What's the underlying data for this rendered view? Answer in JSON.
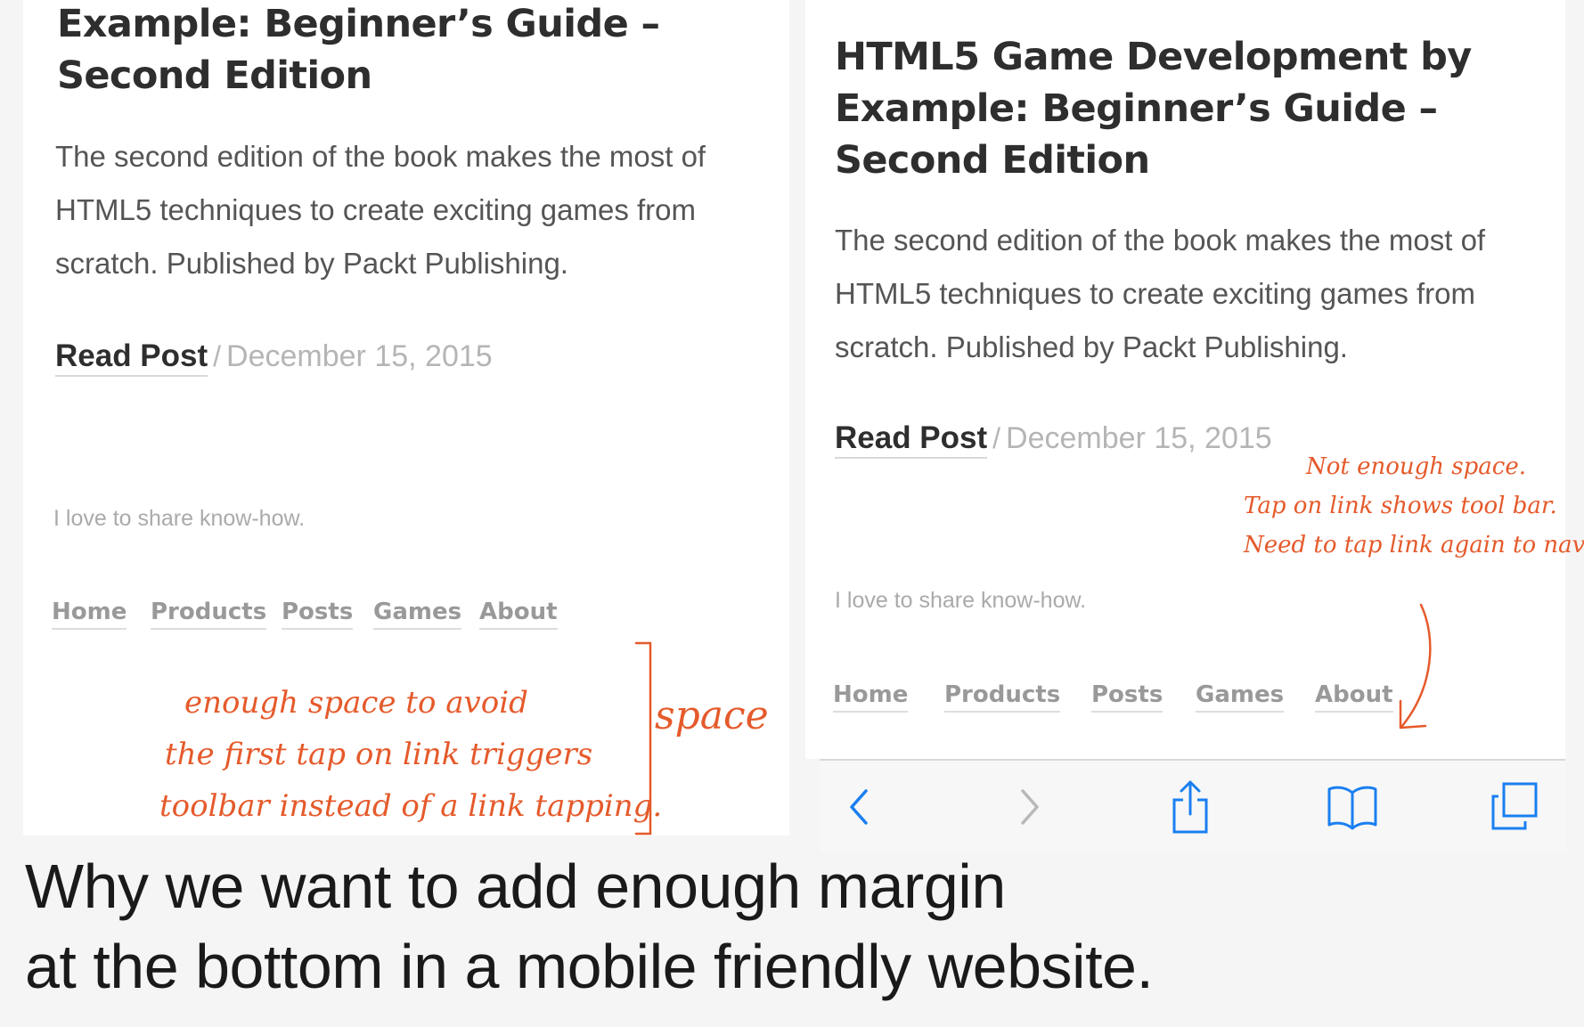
{
  "left_panel": {
    "title_lines": [
      "Example: Beginner’s Guide –",
      "Second Edition"
    ],
    "excerpt_lines": [
      "The second edition of the book makes the most of",
      "HTML5 techniques to create exciting games from",
      "scratch. Published by Packt Publishing."
    ],
    "read_post": "Read Post",
    "separator": "/",
    "date": "December 15, 2015",
    "tagline": "I love to share know-how.",
    "nav": [
      "Home",
      "Products",
      "Posts",
      "Games",
      "About"
    ]
  },
  "right_panel": {
    "title_lines": [
      "HTML5 Game Development by",
      "Example: Beginner’s Guide –",
      "Second Edition"
    ],
    "excerpt_lines": [
      "The second edition of the book makes the most of",
      "HTML5 techniques to create exciting games from",
      "scratch. Published by Packt Publishing."
    ],
    "read_post": "Read Post",
    "separator": "/",
    "date": "December 15, 2015",
    "tagline": "I love to share know-how.",
    "nav": [
      "Home",
      "Products",
      "Posts",
      "Games",
      "About"
    ]
  },
  "annotations": {
    "left_note_lines": [
      "enough space to avoid",
      "the first tap on link triggers",
      "toolbar instead of a link tapping."
    ],
    "space_label": "space",
    "right_note_lines": [
      "Not enough space.",
      "Tap on link shows tool bar.",
      "Need to tap link again to navigate"
    ]
  },
  "toolbar": {
    "icons": [
      "back-chevron-icon",
      "forward-chevron-icon",
      "share-icon",
      "bookmarks-icon",
      "tabs-icon"
    ]
  },
  "caption_lines": [
    "Why we want to add enough margin",
    "at the bottom in a mobile friendly website."
  ],
  "colors": {
    "annotation": "#e55a2b",
    "ios_blue": "#1a7ff0",
    "ios_disabled": "#b8b8b8"
  }
}
